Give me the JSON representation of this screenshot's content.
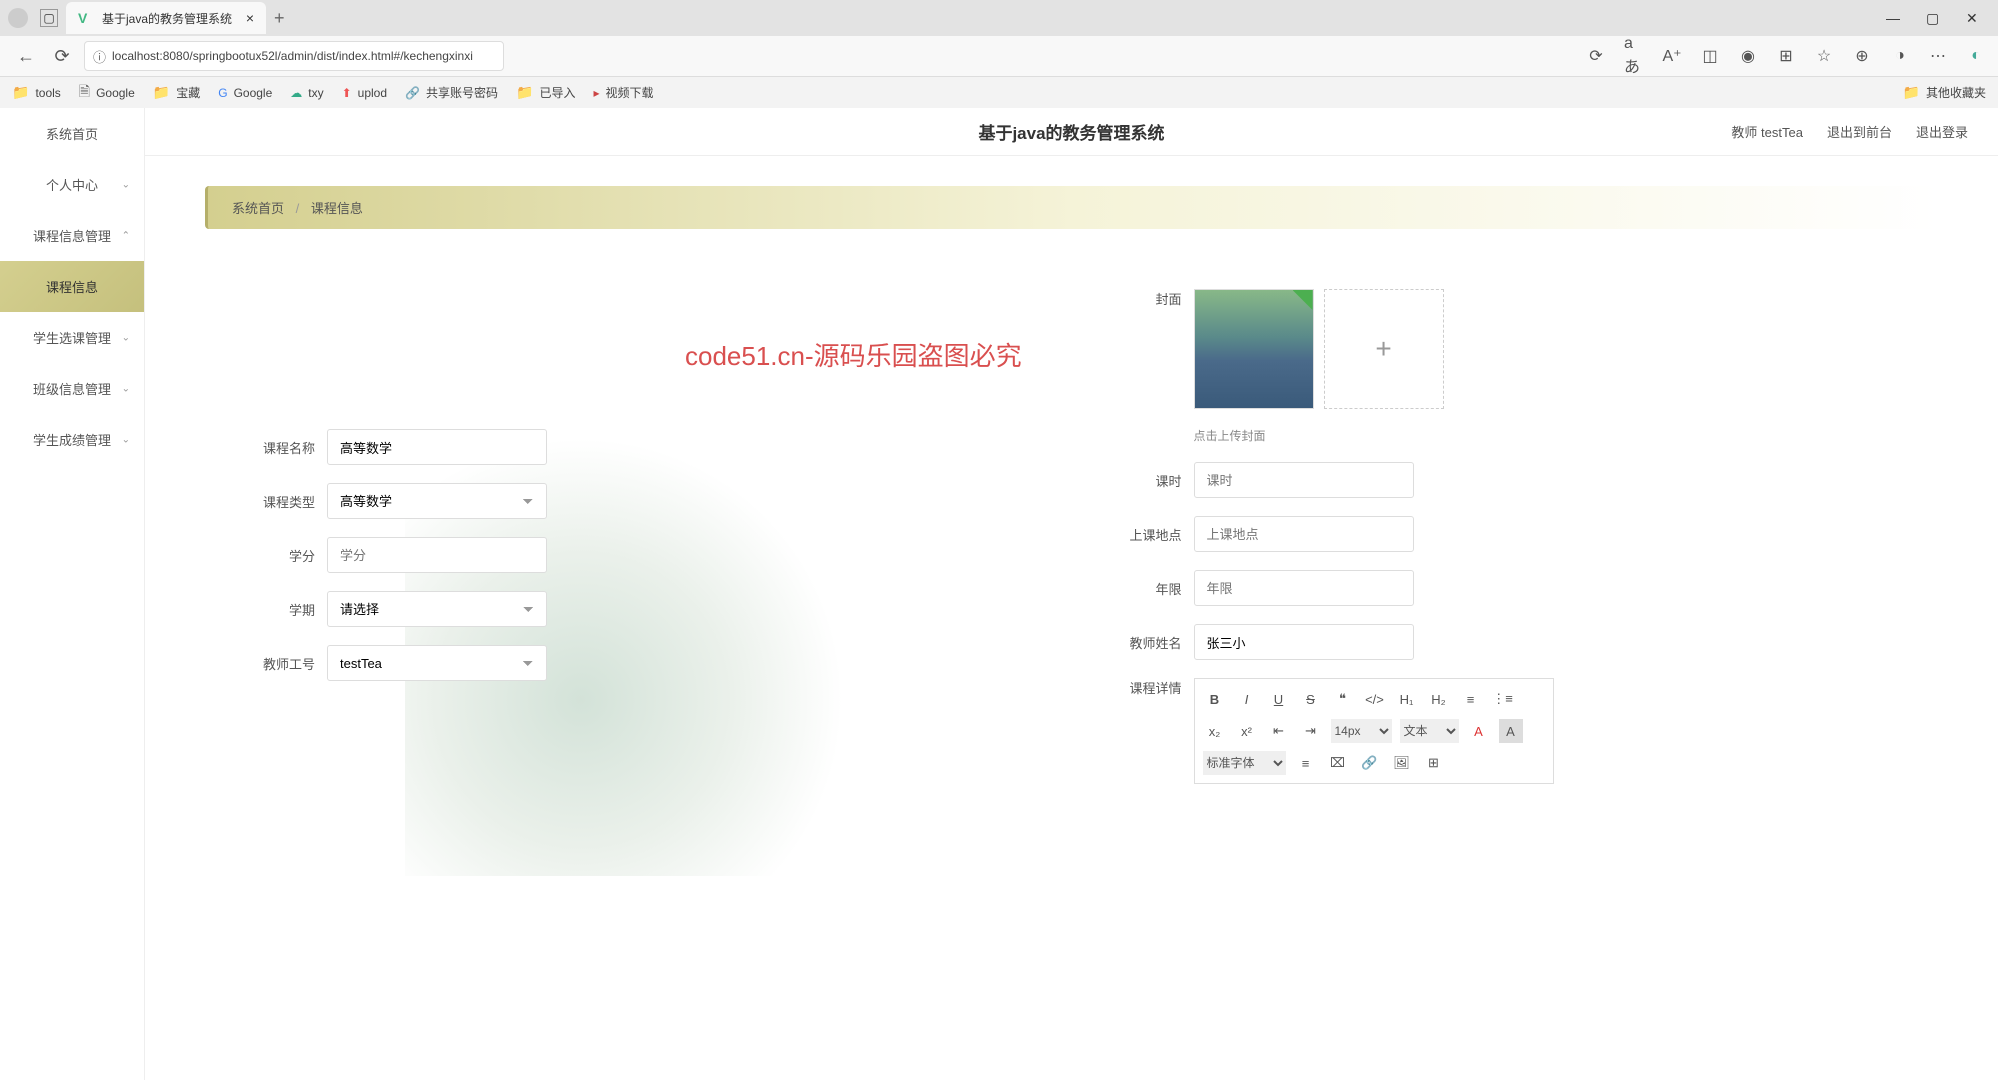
{
  "browser": {
    "tab_title": "基于java的教务管理系统",
    "url": "localhost:8080/springbootux52l/admin/dist/index.html#/kechengxinxi",
    "bookmarks": [
      "tools",
      "Google",
      "宝藏",
      "Google",
      "txy",
      "uplod",
      "共享账号密码",
      "已导入",
      "视频下载"
    ],
    "other_bookmarks": "其他收藏夹"
  },
  "header": {
    "title": "基于java的教务管理系统",
    "user_role": "教师",
    "user_name": "testTea",
    "exit_front": "退出到前台",
    "logout": "退出登录"
  },
  "sidebar": {
    "items": [
      {
        "label": "系统首页",
        "expandable": false
      },
      {
        "label": "个人中心",
        "expandable": true
      },
      {
        "label": "课程信息管理",
        "expandable": true,
        "expanded": true
      },
      {
        "label": "课程信息",
        "expandable": false,
        "active": true
      },
      {
        "label": "学生选课管理",
        "expandable": true
      },
      {
        "label": "班级信息管理",
        "expandable": true
      },
      {
        "label": "学生成绩管理",
        "expandable": true
      }
    ]
  },
  "breadcrumb": {
    "home": "系统首页",
    "current": "课程信息"
  },
  "form": {
    "cover_label": "封面",
    "upload_hint": "点击上传封面",
    "course_name_label": "课程名称",
    "course_name_value": "高等数学",
    "course_type_label": "课程类型",
    "course_type_value": "高等数学",
    "credit_label": "学分",
    "credit_placeholder": "学分",
    "semester_label": "学期",
    "semester_placeholder": "请选择",
    "teacher_id_label": "教师工号",
    "teacher_id_value": "testTea",
    "hours_label": "课时",
    "hours_placeholder": "课时",
    "location_label": "上课地点",
    "location_placeholder": "上课地点",
    "grade_label": "年限",
    "grade_placeholder": "年限",
    "teacher_name_label": "教师姓名",
    "teacher_name_value": "张三小",
    "detail_label": "课程详情"
  },
  "editor": {
    "font_size": "14px",
    "text_label": "文本",
    "font_family": "标准字体"
  },
  "watermark": {
    "text": "code51.cn",
    "red_text": "code51.cn-源码乐园盗图必究"
  }
}
